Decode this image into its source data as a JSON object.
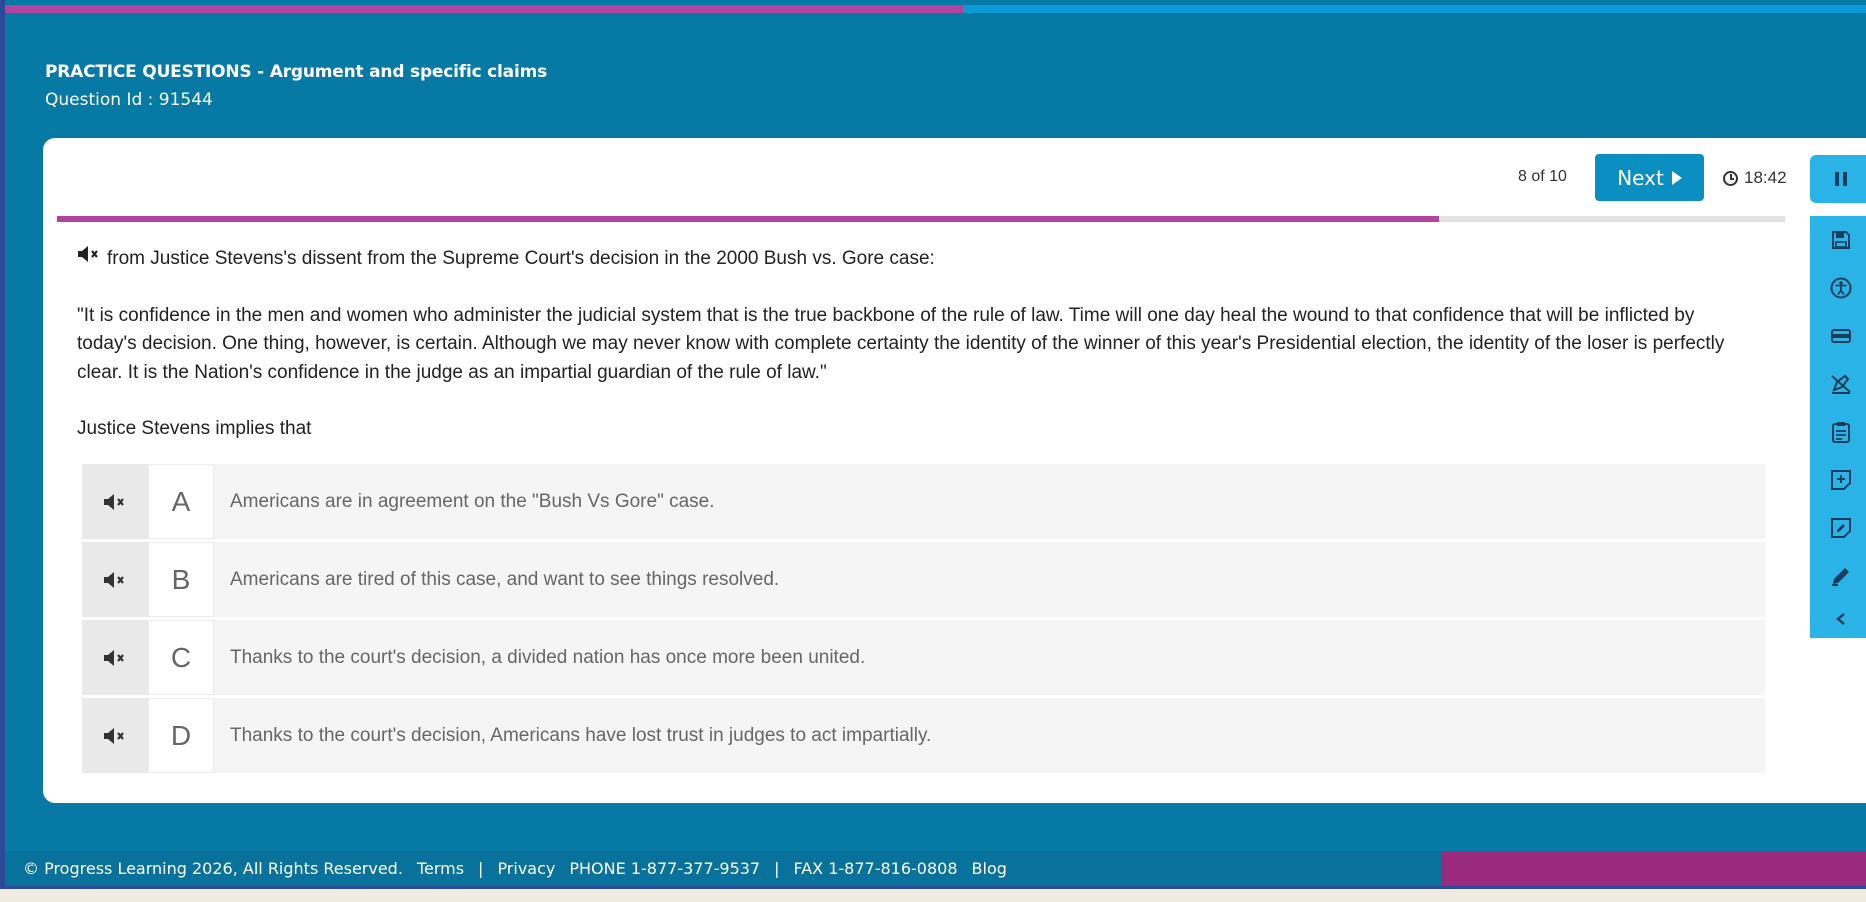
{
  "header": {
    "title": "PRACTICE QUESTIONS - Argument and specific claims",
    "question_id": "Question Id : 91544"
  },
  "progress": {
    "current": 8,
    "total": 10,
    "label": "8 of 10",
    "fraction": 0.8
  },
  "top_progress_fraction": 0.5135,
  "controls": {
    "next_label": "Next",
    "timer": "18:42"
  },
  "question": {
    "intro": "from Justice Stevens's dissent from the Supreme Court's decision in the 2000 Bush vs. Gore case:",
    "quote": "\"It is confidence in the men and women who administer the judicial system that is the true backbone of the rule of law. Time will one day heal the wound to that confidence that will be inflicted by today's decision. One thing, however, is certain. Although we may never know with complete certainty the identity of the winner of this year's Presidential election, the identity of the loser is perfectly clear. It is the Nation's confidence in the judge as an impartial guardian of the rule of law.\"",
    "stem": "Justice Stevens implies that"
  },
  "answers": [
    {
      "letter": "A",
      "text": "Americans are in agreement on the \"Bush Vs Gore\" case."
    },
    {
      "letter": "B",
      "text": "Americans are tired of this case, and want to see things resolved."
    },
    {
      "letter": "C",
      "text": "Thanks to the court's decision, a divided nation has once more been united."
    },
    {
      "letter": "D",
      "text": "Thanks to the court's decision, Americans have lost trust in judges to act impartially."
    }
  ],
  "toolbar_icons": [
    "pause-icon",
    "save-icon",
    "accessibility-icon",
    "line-reader-icon",
    "highlighter-off-icon",
    "clipboard-icon",
    "add-note-icon",
    "note-edit-icon",
    "pencil-icon",
    "chevron-left-icon"
  ],
  "footer": {
    "copyright": "© Progress Learning 2026, All Rights Reserved.",
    "terms": "Terms",
    "separator": "|",
    "privacy": "Privacy",
    "phone": "PHONE 1-877-377-9537",
    "fax": "FAX 1-877-816-0808",
    "blog": "Blog"
  },
  "colors": {
    "brand_blue": "#0779a5",
    "accent_magenta": "#b3449d",
    "button_blue": "#0b8fc2",
    "toolbar_blue": "#2ab3e7"
  }
}
